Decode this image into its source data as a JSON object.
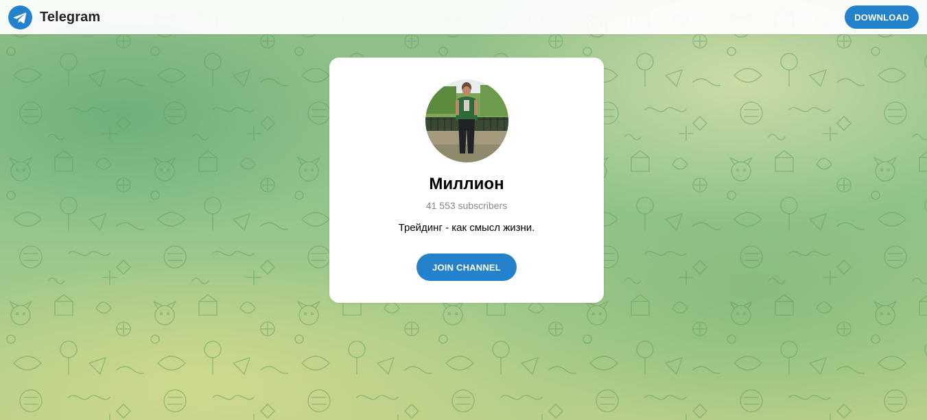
{
  "header": {
    "brand": "Telegram",
    "download_label": "DOWNLOAD"
  },
  "channel": {
    "title": "Миллион",
    "subscribers": "41 553 subscribers",
    "description": "Трейдинг - как смысл жизни.",
    "join_label": "JOIN CHANNEL"
  },
  "colors": {
    "accent": "#2481cc",
    "background_green": "#8fc48a"
  },
  "icons": {
    "logo": "telegram-paper-plane-icon"
  }
}
